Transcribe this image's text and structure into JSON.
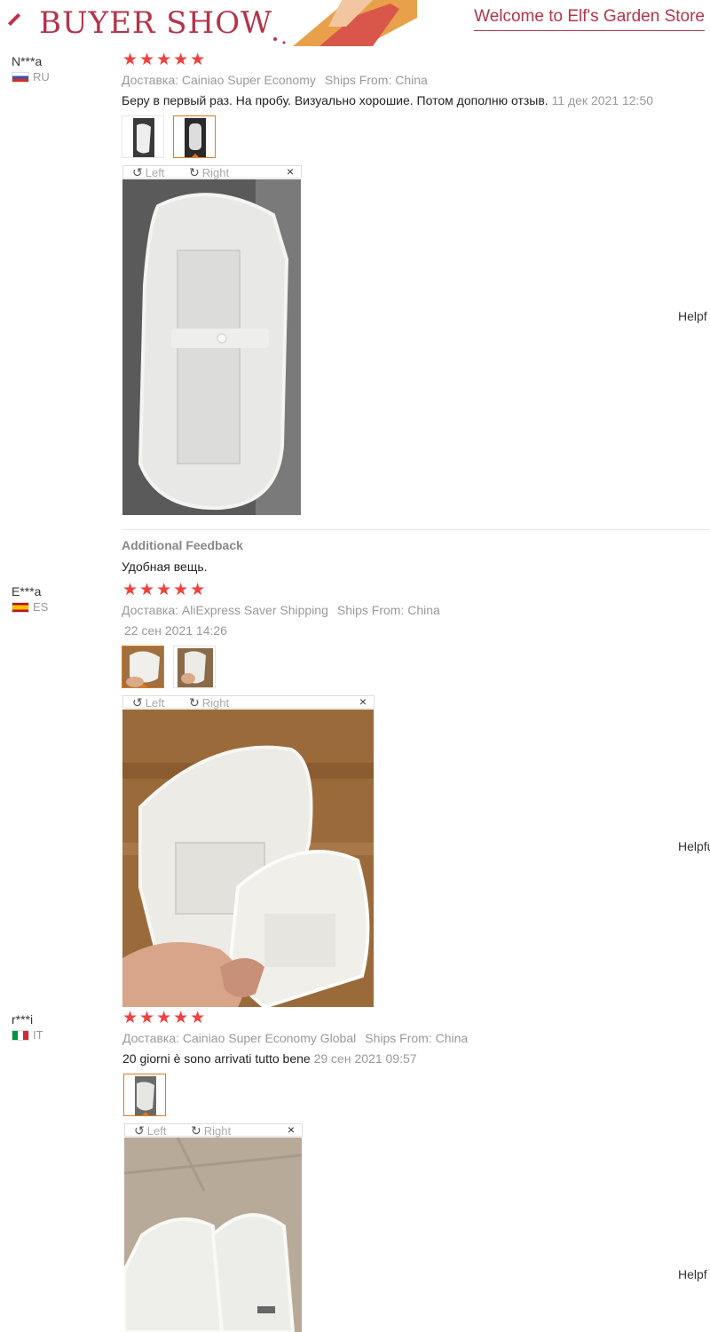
{
  "banner": {
    "title": "BUYER SHOW",
    "welcome": "Welcome to Elf's Garden Store"
  },
  "colors": {
    "brand": "#b4344a",
    "star": "#f04040",
    "selected_border": "#e07a1a"
  },
  "reviews": [
    {
      "user": "N***a",
      "country": "RU",
      "stars": "★★★★★",
      "shipping_method": "Доставка: Cainiao Super Economy",
      "ships_from": "Ships From: China",
      "comment": "Беру в первый раз. На пробу. Визуально хорошие. Потом дополню отзыв.",
      "date": "11 дек 2021 12:50",
      "toolbar": {
        "left": "Left",
        "right": "Right",
        "close": "×"
      },
      "helpful": "Helpf",
      "additional_title": "Additional Feedback",
      "additional_text": "Удобная вещь."
    },
    {
      "user": "E***a",
      "country": "ES",
      "stars": "★★★★★",
      "shipping_method": "Доставка: AliExpress Saver Shipping",
      "ships_from": "Ships From: China",
      "date": "22 сен 2021 14:26",
      "toolbar": {
        "left": "Left",
        "right": "Right",
        "close": "×"
      },
      "helpful": "Helpfu"
    },
    {
      "user": "r***i",
      "country": "IT",
      "stars": "★★★★★",
      "shipping_method": "Доставка: Cainiao Super Economy Global",
      "ships_from": "Ships From: China",
      "comment": "20 giorni è sono arrivati tutto bene",
      "date": "29 сен 2021 09:57",
      "toolbar": {
        "left": "Left",
        "right": "Right",
        "close": "×"
      },
      "helpful": "Helpf"
    }
  ],
  "icons": {
    "rotate_left": "rotate-left-icon",
    "rotate_right": "rotate-right-icon",
    "close": "close-icon"
  }
}
